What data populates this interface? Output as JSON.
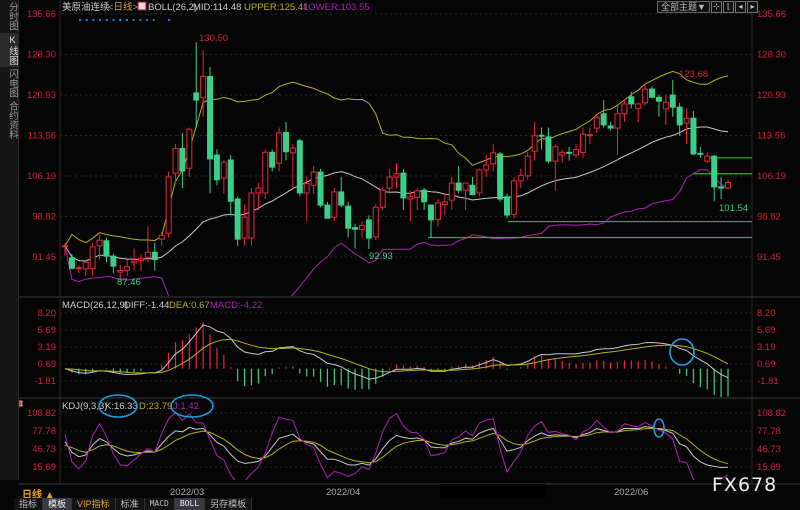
{
  "sidebar": {
    "items": [
      {
        "label": "分时图",
        "active": false
      },
      {
        "label": "K线图",
        "active": true
      },
      {
        "label": "闪电图",
        "active": false
      },
      {
        "label": "合约资料",
        "active": false
      }
    ]
  },
  "header": {
    "symbol": "美原油连续",
    "period": "<日线>",
    "boll_label": "BOLL(26,2)",
    "mid": "MID:114.48",
    "upper": "UPPER:125.41",
    "lower": "LOWER:103.55",
    "theme_button": "全部主题▼",
    "icon_buttons": [
      "fit-icon",
      "expand-left-icon",
      "shift-left-icon",
      "shift-right-icon"
    ]
  },
  "macd_header": {
    "label": "MACD(26,12,9)",
    "diff": "DIFF:-1.44",
    "dea": "DEA:0.67",
    "macd": "MACD:-4.22"
  },
  "kdj_header": {
    "label": "KDJ(9,3,3)",
    "k": "K:16.33",
    "d": "D:23.79",
    "j": "J:1.42"
  },
  "colors": {
    "up": "#e8263a",
    "down": "#3ccf8c",
    "mid": "#c8c8c8",
    "upper": "#b8b020",
    "lower": "#b020b8",
    "axis": "#d2213a",
    "annotation": "#1aa0e0",
    "support": "#22c022"
  },
  "footer": {
    "period_label": "日线 ▲",
    "tabs": [
      "指标",
      "模板",
      "VIP指标",
      "标准",
      "MACD",
      "BOLL",
      "另存模板"
    ],
    "active_tabs": [
      "模板",
      "BOLL"
    ],
    "watermark": "FX678"
  },
  "chart_data": [
    {
      "type": "candlestick",
      "title": "美原油连续<日线>",
      "yticks": [
        "135.66",
        "128.30",
        "120.93",
        "113.56",
        "106.19",
        "98.82",
        "91.45"
      ],
      "ylim": [
        91.45,
        135.66
      ],
      "xticks": [
        "2022/03",
        "2022/04",
        "2022/06"
      ],
      "annotations": {
        "high_1": "130.50",
        "low_1": "87.46",
        "low_2": "92.93",
        "high_2": "123.68",
        "low_3": "101.54"
      },
      "support_levels": [
        109.5,
        106.6,
        97.9,
        95.0
      ],
      "ohlc": [
        [
          93.4,
          94,
          91.7,
          93.5
        ],
        [
          91.3,
          92,
          89.2,
          89.4
        ],
        [
          89.5,
          90,
          88.5,
          89.5
        ],
        [
          89.3,
          91,
          88,
          90.5
        ],
        [
          89.4,
          94,
          88,
          93.3
        ],
        [
          93.5,
          95.5,
          91,
          94.5
        ],
        [
          94.4,
          95,
          90.5,
          91.6
        ],
        [
          91.6,
          92,
          88.5,
          89.8
        ],
        [
          88.7,
          90,
          87.46,
          89
        ],
        [
          89,
          91,
          88,
          89.7
        ],
        [
          90.4,
          93,
          89,
          90.7
        ],
        [
          90.8,
          92,
          89,
          91.2
        ],
        [
          91.4,
          97,
          90.5,
          92.3
        ],
        [
          92.3,
          94,
          89,
          91
        ],
        [
          94.7,
          96,
          93.5,
          95.4
        ],
        [
          95.8,
          107,
          95,
          106
        ],
        [
          106.7,
          112,
          105,
          111.2
        ],
        [
          111.2,
          114,
          104,
          107.1
        ],
        [
          107.6,
          115,
          106,
          114.7
        ],
        [
          121.3,
          130.5,
          115,
          120
        ],
        [
          120.4,
          129,
          117,
          124.3
        ],
        [
          124.3,
          126,
          103,
          109.3
        ],
        [
          110,
          111,
          104.5,
          105.5
        ],
        [
          105.8,
          109,
          103,
          108.7
        ],
        [
          109.1,
          110,
          99,
          101.6
        ],
        [
          102,
          102.5,
          93.5,
          94.7
        ],
        [
          94.9,
          101,
          93.5,
          98.7
        ],
        [
          94.9,
          104,
          93.5,
          103.1
        ],
        [
          103.1,
          105,
          100,
          104
        ],
        [
          103.1,
          111,
          102,
          110.5
        ],
        [
          110.5,
          111,
          107,
          107.8
        ],
        [
          108.5,
          115,
          107,
          114
        ],
        [
          114.1,
          116,
          109,
          110.6
        ],
        [
          110.4,
          112,
          104,
          111.3
        ],
        [
          112.6,
          113,
          102.5,
          103.1
        ],
        [
          103.1,
          106,
          98,
          104.8
        ],
        [
          104.5,
          108,
          103,
          106.9
        ],
        [
          106.9,
          107.5,
          100.5,
          100.9
        ],
        [
          100.9,
          101.5,
          98.5,
          98.5
        ],
        [
          98.7,
          104,
          98,
          103.3
        ],
        [
          103.3,
          106,
          100.5,
          100.9
        ],
        [
          100.7,
          101.5,
          95,
          96.7
        ],
        [
          96.8,
          97.5,
          93,
          96.5
        ],
        [
          96.5,
          98,
          95,
          97.2
        ],
        [
          98.2,
          99,
          92.93,
          94.9
        ],
        [
          95.1,
          101,
          94.5,
          100.5
        ],
        [
          100.5,
          104,
          100,
          103.6
        ],
        [
          104,
          107.5,
          103,
          106
        ],
        [
          106,
          108.5,
          104,
          106.6
        ],
        [
          106.7,
          107.5,
          100,
          102.2
        ],
        [
          102,
          103.5,
          98,
          102.4
        ],
        [
          102.3,
          104,
          100,
          103.5
        ],
        [
          103.6,
          104,
          100,
          101.5
        ],
        [
          100.9,
          101,
          95,
          98.2
        ],
        [
          98.3,
          102,
          97,
          101.3
        ],
        [
          101,
          103,
          99,
          101.5
        ],
        [
          101.8,
          106,
          100,
          104.9
        ],
        [
          104.9,
          108,
          103,
          103.6
        ],
        [
          103.6,
          105,
          100,
          104.9
        ],
        [
          104.5,
          106,
          103.5,
          102.8
        ],
        [
          103.1,
          107.5,
          102.5,
          107.3
        ],
        [
          107.3,
          110,
          106,
          108.2
        ],
        [
          108.4,
          112,
          107,
          110.4
        ],
        [
          110.2,
          110.5,
          101.5,
          102
        ],
        [
          102.4,
          103,
          98.5,
          99.1
        ],
        [
          99.2,
          106,
          98.5,
          105.3
        ],
        [
          105.3,
          107.5,
          104,
          106.3
        ],
        [
          106.2,
          110.5,
          105.5,
          109.8
        ],
        [
          110.7,
          116,
          109,
          113.5
        ],
        [
          113.6,
          115,
          111,
          113.5
        ],
        [
          113.3,
          115,
          108.5,
          108.9
        ],
        [
          108.9,
          112,
          103.5,
          111.5
        ],
        [
          110,
          111,
          108.5,
          110.5
        ],
        [
          110.5,
          111.5,
          109,
          110.4
        ],
        [
          110,
          112,
          109.5,
          111
        ],
        [
          110.5,
          115,
          109.5,
          113.8
        ],
        [
          113.6,
          115,
          112,
          113.7
        ],
        [
          114.9,
          117.5,
          114,
          116.9
        ],
        [
          117.5,
          120,
          115,
          115.5
        ],
        [
          115.3,
          116,
          114.5,
          114.9
        ],
        [
          114.9,
          119,
          110,
          117.5
        ],
        [
          117.5,
          120,
          116,
          119.3
        ],
        [
          120.6,
          121.5,
          118.5,
          119.3
        ],
        [
          118.5,
          119.5,
          116,
          119.3
        ],
        [
          119.5,
          123,
          119,
          122
        ],
        [
          122,
          122.5,
          120.5,
          120.5
        ],
        [
          120.5,
          121,
          117,
          119.8
        ],
        [
          118.4,
          121,
          115.5,
          119.6
        ],
        [
          120.9,
          123.68,
          117,
          118.7
        ],
        [
          118.7,
          119.5,
          113.5,
          115.5
        ],
        [
          115.8,
          118.5,
          112,
          116.7
        ],
        [
          116.7,
          118,
          110,
          110.2
        ],
        [
          110.3,
          111.5,
          109.5,
          110.2
        ],
        [
          108.9,
          110.5,
          108.5,
          109.8
        ],
        [
          109.8,
          110,
          101.54,
          104.2
        ],
        [
          104.2,
          106,
          102,
          104
        ],
        [
          104,
          105.5,
          103.8,
          105
        ]
      ]
    },
    {
      "type": "line",
      "title": "MACD(26,12,9)",
      "yticks": [
        "8.20",
        "5.69",
        "3.19",
        "0.69",
        "-1.81"
      ],
      "ylim": [
        -1.81,
        8.2
      ]
    },
    {
      "type": "line",
      "title": "KDJ(9,3,3)",
      "yticks": [
        "108.82",
        "77.78",
        "46.73",
        "15.69"
      ],
      "ylim": [
        15.69,
        108.82
      ]
    }
  ]
}
